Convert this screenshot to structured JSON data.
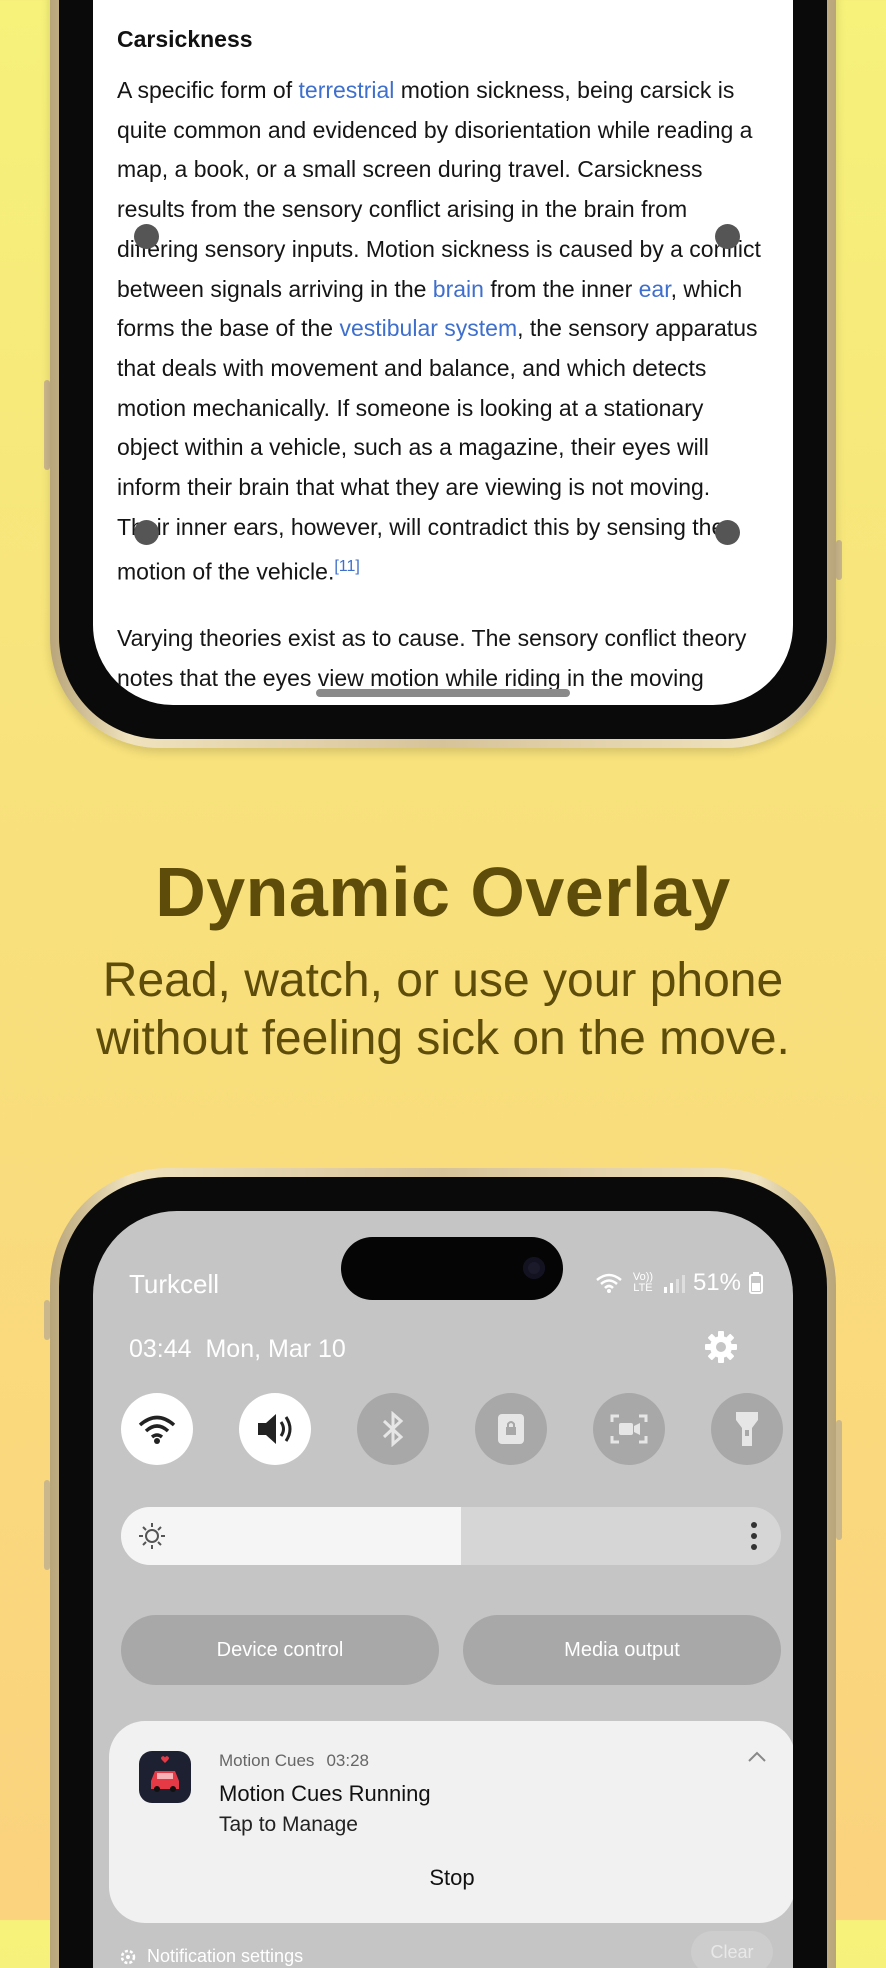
{
  "article": {
    "heading": "Carsickness",
    "p1_a": "A specific form of ",
    "p1_link1": "terrestrial",
    "p1_b": " motion sickness, being carsick is quite common and evidenced by disorientation while reading a map, a book, or a small screen during travel. Carsickness results from the sensory conflict arising in the brain from differing sensory inputs. Motion sickness is caused by a conflict between signals arriving in the ",
    "p1_link2": "brain",
    "p1_c": " from the inner ",
    "p1_link3": "ear",
    "p1_d": ", which forms the base of the ",
    "p1_link4": "vestibular system",
    "p1_e": ", the sensory apparatus that deals with movement and balance, and which detects motion mechanically. If someone is looking at a stationary object within a vehicle, such as a magazine, their eyes will inform their brain that what they are viewing is not moving. Their inner ears, however, will contradict this by sensing the motion of the vehicle.",
    "p1_ref": "[11]",
    "p2": "Varying theories exist as to cause. The sensory conflict theory notes that the eyes view motion while riding in the moving"
  },
  "promo": {
    "headline": "Dynamic Overlay",
    "subline_1": "Read, watch, or use your phone",
    "subline_2": "without feeling sick on the move."
  },
  "status_bar": {
    "carrier": "Turkcell",
    "volte": "Vo)) LTE",
    "battery": "51%"
  },
  "panel": {
    "time": "03:44",
    "date": "Mon, Mar 10",
    "device_control": "Device control",
    "media_output": "Media output",
    "notification_settings": "Notification settings",
    "clear": "Clear"
  },
  "notification": {
    "app": "Motion Cues",
    "time": "03:28",
    "title": "Motion Cues Running",
    "body": "Tap to Manage",
    "action": "Stop"
  },
  "quick_tiles": [
    "wifi-icon",
    "sound-icon",
    "bluetooth-icon",
    "lock-rotation-icon",
    "screen-recorder-icon",
    "flashlight-icon"
  ],
  "colors": {
    "link": "#3f6fcd",
    "headline": "#5e4d0a",
    "accent_bg": "#f6f27a"
  }
}
